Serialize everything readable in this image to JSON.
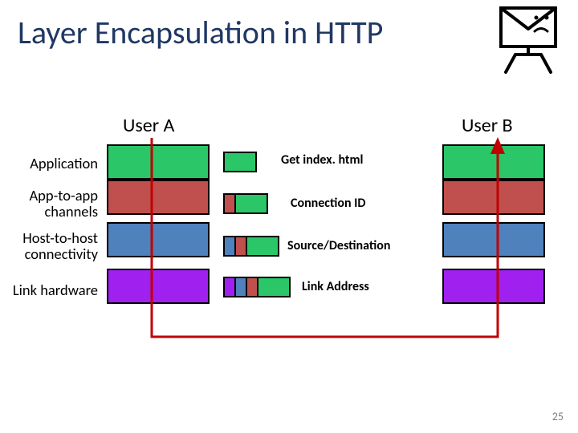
{
  "title": "Layer Encapsulation in HTTP",
  "users": {
    "a": "User A",
    "b": "User B"
  },
  "layers": {
    "app": "Application",
    "trans": "App-to-app channels",
    "net": "Host-to-host connectivity",
    "link": "Link hardware"
  },
  "messages": {
    "app": "Get index. html",
    "trans": "Connection ID",
    "net": "Source/Destination",
    "link": "Link Address"
  },
  "colors": {
    "green": "#2AC667",
    "red": "#C0504D",
    "blue": "#4F81BD",
    "purple": "#A020F0"
  },
  "page_number": "25"
}
